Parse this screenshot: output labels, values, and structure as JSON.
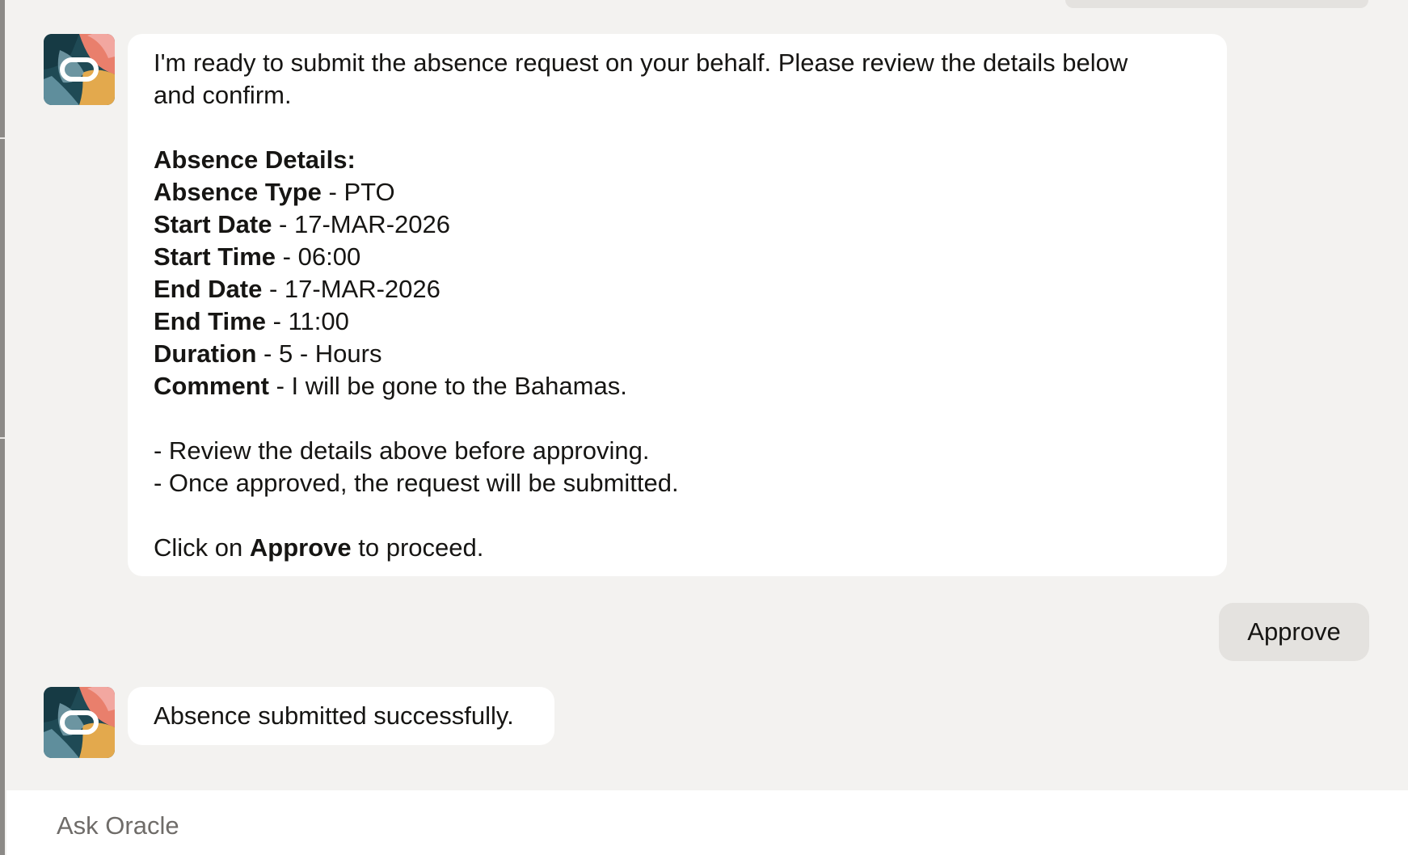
{
  "colors": {
    "background": "#f3f2f0",
    "bot_bubble": "#ffffff",
    "user_chip": "#e4e2df",
    "text": "#161513",
    "placeholder": "#6f6c69"
  },
  "assistant": {
    "avatar_icon": "oracle-avatar-icon"
  },
  "messages": {
    "review": {
      "intro_line1": "I'm ready to submit the absence request on your behalf. Please review the details below",
      "intro_line2": "and confirm.",
      "details_heading": "Absence Details:",
      "fields": [
        {
          "label": "Absence Type",
          "sep": " - ",
          "value": "PTO"
        },
        {
          "label": "Start Date",
          "sep": " - ",
          "value": "17-MAR-2026"
        },
        {
          "label": "Start Time",
          "sep": " - ",
          "value": "06:00"
        },
        {
          "label": "End Date",
          "sep": " - ",
          "value": "17-MAR-2026"
        },
        {
          "label": "End Time",
          "sep": " - ",
          "value": "11:00"
        },
        {
          "label": "Duration",
          "sep": " - ",
          "value": "5 - Hours"
        },
        {
          "label": "Comment",
          "sep": " - ",
          "value": "I will be gone to the Bahamas."
        }
      ],
      "notes": [
        "- Review the details above before approving.",
        "- Once approved, the request will be submitted."
      ],
      "cta_prefix": "Click on ",
      "cta_action": "Approve",
      "cta_suffix": " to proceed."
    },
    "user_reply": "Approve",
    "confirmation": "Absence submitted successfully."
  },
  "composer": {
    "placeholder": "Ask Oracle",
    "value": ""
  }
}
